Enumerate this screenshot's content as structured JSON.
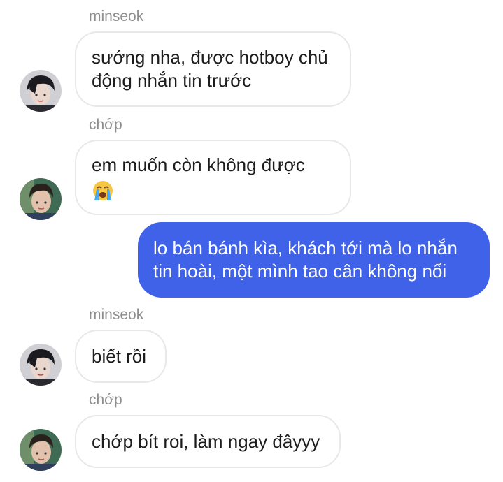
{
  "messages": [
    {
      "sender": "minseok",
      "avatar_icon": "minseok-avatar",
      "lines": [
        "sướng nha, được hotboy chủ",
        "động nhắn tin trước"
      ]
    },
    {
      "sender": "chớp",
      "avatar_icon": "chop-avatar",
      "lines": [
        "em muốn còn không được"
      ],
      "emoji_icon": "loudly-crying-face-icon"
    },
    {
      "direction": "outgoing",
      "lines": [
        "lo bán bánh kìa, khách tới mà lo nhắn",
        "tin hoài, một mình tao cân không nổi"
      ]
    },
    {
      "sender": "minseok",
      "avatar_icon": "minseok-avatar",
      "lines": [
        "biết rồi"
      ]
    },
    {
      "sender": "chớp",
      "avatar_icon": "chop-avatar",
      "lines": [
        "chớp bít roi, làm ngay đâyyy"
      ]
    }
  ],
  "colors": {
    "outgoing_bubble": "#3f62e8",
    "incoming_bubble_border": "#e8e8e8",
    "sender_name": "#8e8e8e"
  }
}
